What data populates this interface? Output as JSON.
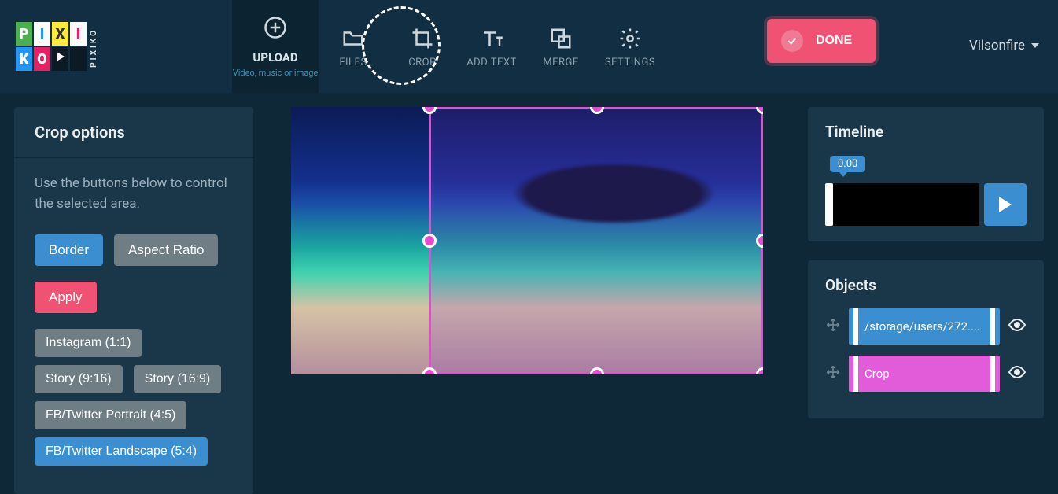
{
  "brand": {
    "name": "PIXIKO",
    "vertical": "PIXIKO"
  },
  "header": {
    "upload": {
      "title": "UPLOAD",
      "subtitle": "Video, music or image"
    },
    "items": [
      {
        "key": "files",
        "label": "FILES"
      },
      {
        "key": "crop",
        "label": "CROP"
      },
      {
        "key": "addtext",
        "label": "ADD TEXT"
      },
      {
        "key": "merge",
        "label": "MERGE"
      },
      {
        "key": "settings",
        "label": "SETTINGS"
      }
    ],
    "done": "DONE",
    "user": "Vilsonfire"
  },
  "leftPanel": {
    "title": "Crop options",
    "help": "Use the buttons below to control the selected area.",
    "border": "Border",
    "aspect": "Aspect Ratio",
    "apply": "Apply",
    "presets": [
      "Instagram (1:1)",
      "Story (9:16)",
      "Story (16:9)",
      "FB/Twitter Portrait (4:5)",
      "FB/Twitter Landscape (5:4)"
    ],
    "activePresetIndex": 4
  },
  "timeline": {
    "title": "Timeline",
    "position": "0.00"
  },
  "objects": {
    "title": "Objects",
    "items": [
      {
        "label": "/storage/users/272....",
        "color": "blue"
      },
      {
        "label": "Crop",
        "color": "pink"
      }
    ]
  }
}
